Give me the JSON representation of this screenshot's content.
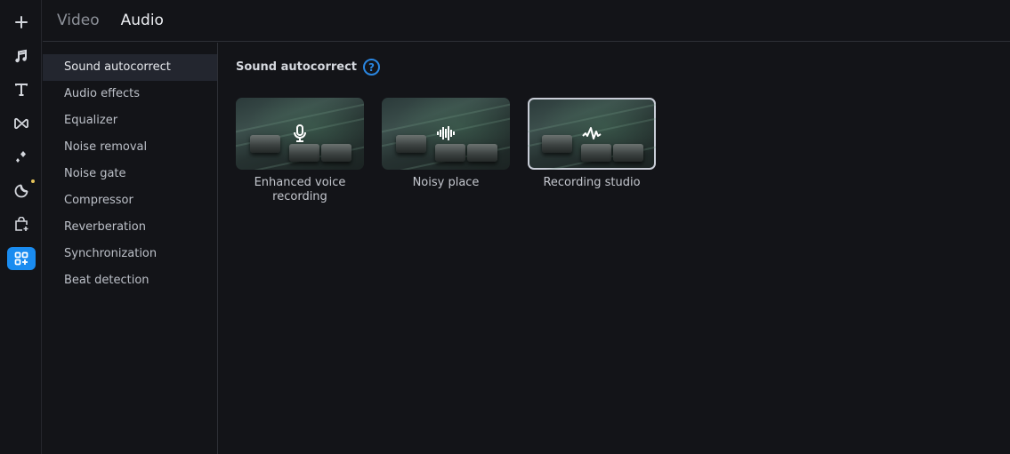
{
  "rail": {
    "items": [
      {
        "name": "add",
        "icon": "plus-icon"
      },
      {
        "name": "music",
        "icon": "music-note-icon"
      },
      {
        "name": "titles",
        "icon": "text-icon"
      },
      {
        "name": "transitions",
        "icon": "transition-bowtie-icon"
      },
      {
        "name": "effects",
        "icon": "sparkle-icon"
      },
      {
        "name": "stickers",
        "icon": "sticker-icon",
        "badge": true
      },
      {
        "name": "store",
        "icon": "shopping-bag-add-icon"
      },
      {
        "name": "more-tools",
        "icon": "apps-add-icon",
        "active": true
      }
    ],
    "badge_color": "#e5c35a",
    "active_color": "#1a8cf0"
  },
  "tabs": [
    {
      "label": "Video",
      "active": false
    },
    {
      "label": "Audio",
      "active": true
    }
  ],
  "subnav": {
    "items": [
      {
        "label": "Sound autocorrect",
        "active": true
      },
      {
        "label": "Audio effects"
      },
      {
        "label": "Equalizer"
      },
      {
        "label": "Noise removal"
      },
      {
        "label": "Noise gate"
      },
      {
        "label": "Compressor"
      },
      {
        "label": "Reverberation"
      },
      {
        "label": "Synchronization"
      },
      {
        "label": "Beat detection"
      }
    ]
  },
  "content": {
    "title": "Sound autocorrect",
    "help_glyph": "?",
    "presets": [
      {
        "label": "Enhanced voice recording",
        "icon": "microphone-icon",
        "selected": false
      },
      {
        "label": "Noisy place",
        "icon": "sound-wave-icon",
        "selected": false
      },
      {
        "label": "Recording studio",
        "icon": "waveform-icon",
        "selected": true
      }
    ]
  }
}
